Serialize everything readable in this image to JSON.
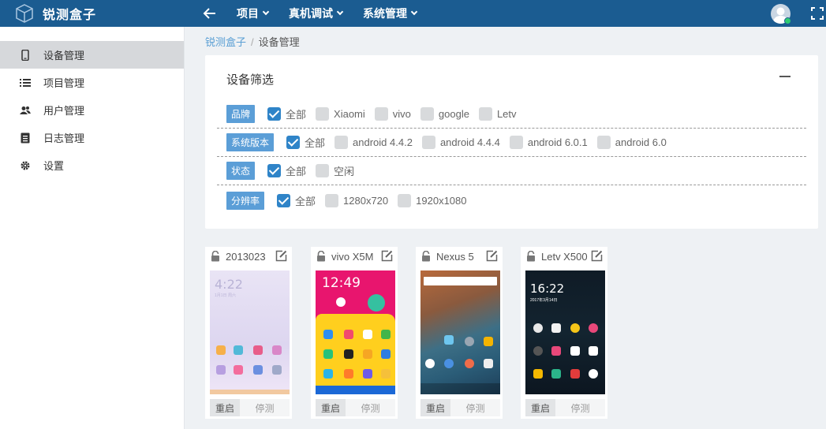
{
  "app": {
    "brand": "锐测盒子"
  },
  "topbar": {
    "menus": [
      {
        "label": "项目"
      },
      {
        "label": "真机调试"
      },
      {
        "label": "系统管理"
      }
    ]
  },
  "sidebar": {
    "items": [
      {
        "label": "设备管理",
        "icon": "phone-icon",
        "active": true
      },
      {
        "label": "项目管理",
        "icon": "list-icon"
      },
      {
        "label": "用户管理",
        "icon": "users-icon"
      },
      {
        "label": "日志管理",
        "icon": "log-icon"
      },
      {
        "label": "设置",
        "icon": "gear-icon"
      }
    ]
  },
  "breadcrumb": {
    "home": "锐测盒子",
    "separator": "/",
    "current": "设备管理"
  },
  "filter": {
    "title": "设备筛选",
    "rows": [
      {
        "tag": "品牌",
        "options": [
          {
            "label": "全部",
            "checked": true
          },
          {
            "label": "Xiaomi",
            "checked": false
          },
          {
            "label": "vivo",
            "checked": false
          },
          {
            "label": "google",
            "checked": false
          },
          {
            "label": "Letv",
            "checked": false
          }
        ]
      },
      {
        "tag": "系统版本",
        "options": [
          {
            "label": "全部",
            "checked": true
          },
          {
            "label": "android 4.4.2",
            "checked": false
          },
          {
            "label": "android 4.4.4",
            "checked": false
          },
          {
            "label": "android 6.0.1",
            "checked": false
          },
          {
            "label": "android 6.0",
            "checked": false
          }
        ]
      },
      {
        "tag": "状态",
        "options": [
          {
            "label": "全部",
            "checked": true
          },
          {
            "label": "空闲",
            "checked": false
          }
        ]
      },
      {
        "tag": "分辨率",
        "options": [
          {
            "label": "全部",
            "checked": true
          },
          {
            "label": "1280x720",
            "checked": false
          },
          {
            "label": "1920x1080",
            "checked": false
          }
        ]
      }
    ]
  },
  "devices": [
    {
      "name": "2013023",
      "screen": {
        "time": "4:22",
        "date": "1月1日 周六"
      },
      "reboot": "重启",
      "stop": "停测"
    },
    {
      "name": "vivo X5M",
      "screen": {
        "time": "12:49",
        "date": ""
      },
      "reboot": "重启",
      "stop": "停测"
    },
    {
      "name": "Nexus 5",
      "screen": {
        "time": "",
        "date": ""
      },
      "reboot": "重启",
      "stop": "停测"
    },
    {
      "name": "Letv X500",
      "screen": {
        "time": "16:22",
        "date": "2017年3月14日"
      },
      "reboot": "重启",
      "stop": "停测"
    }
  ],
  "colors": {
    "topbar": "#1b5c91",
    "accent": "#2f84c8",
    "tag": "#5b9ed7"
  }
}
